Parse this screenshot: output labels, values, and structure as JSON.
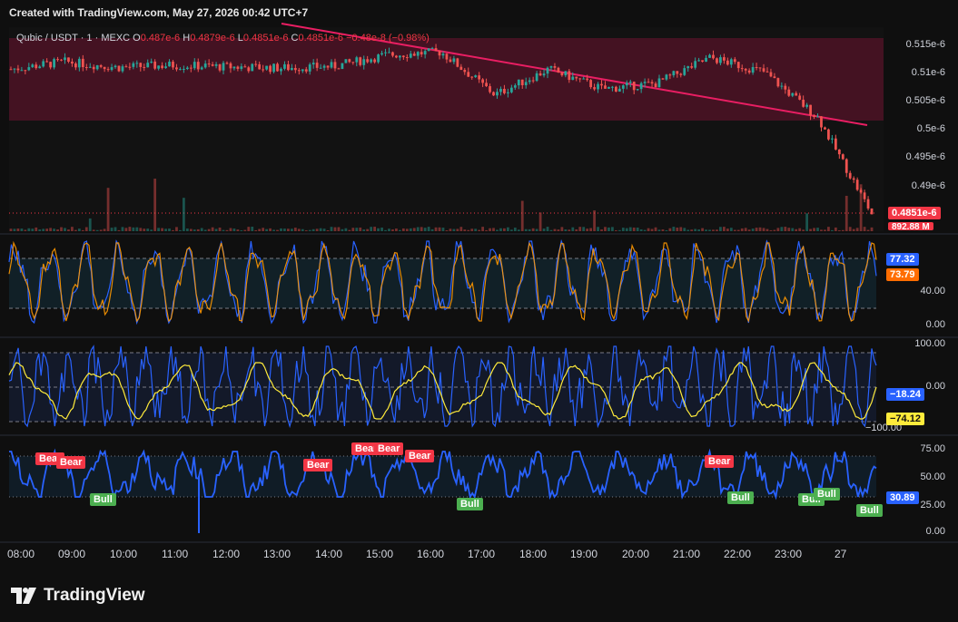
{
  "header": {
    "created_text": "Created with TradingView.com, May 27, 2026 00:42 UTC+7"
  },
  "legend": {
    "symbol": "Qubic / USDT · 1 · MEXC",
    "open_label": "O",
    "open": "0.487e-6",
    "high_label": "H",
    "high": "0.4879e-6",
    "low_label": "L",
    "low": "0.4851e-6",
    "close_label": "C",
    "close": "0.4851e-6",
    "change": "−0.48e-8 (−0.98%)"
  },
  "price_axis": [
    "0.515e-6",
    "0.51e-6",
    "0.505e-6",
    "0.5e-6",
    "0.495e-6",
    "0.49e-6"
  ],
  "current_price": {
    "label": "0.4851e-6",
    "color": "#f23645"
  },
  "volume_label": "892.88 M",
  "osc1": {
    "axis": [
      "40.00",
      "0.00"
    ],
    "value_a": "77.32",
    "value_b": "73.79"
  },
  "osc2": {
    "axis": [
      "100.00",
      "0.00",
      "−100.00"
    ],
    "value_a": "−18.24",
    "value_b": "−74.12"
  },
  "osc3": {
    "axis": [
      "75.00",
      "50.00",
      "25.00",
      "0.00"
    ],
    "value": "30.89",
    "signals": [
      "Bear",
      "Bear",
      "Bear",
      "Bear",
      "Bear",
      "Bear",
      "Bear",
      "Bull",
      "Bull",
      "Bull",
      "Bull",
      "Bull",
      "Bull"
    ]
  },
  "time_axis": [
    "08:00",
    "09:00",
    "10:00",
    "11:00",
    "12:00",
    "13:00",
    "14:00",
    "15:00",
    "16:00",
    "17:00",
    "18:00",
    "19:00",
    "20:00",
    "21:00",
    "22:00",
    "23:00",
    "27"
  ],
  "branding": {
    "logo_text": "TradingView"
  },
  "colors": {
    "bg": "#0f0f0f",
    "up": "#26a69a",
    "down": "#ef5350",
    "trendline": "#e91e63",
    "zone": "#6e1230",
    "osc_blue": "#2962ff",
    "osc_orange": "#ff9800",
    "osc_yellow": "#ffeb3b",
    "bull": "#4caf50",
    "bear": "#f23645"
  },
  "chart_data": {
    "type": "line",
    "title": "Qubic / USDT · 1 · MEXC",
    "x": [
      "08:00",
      "09:00",
      "10:00",
      "11:00",
      "12:00",
      "13:00",
      "14:00",
      "15:00",
      "16:00",
      "17:00",
      "18:00",
      "19:00",
      "20:00",
      "21:00",
      "22:00",
      "23:00",
      "27"
    ],
    "series": [
      {
        "name": "Close",
        "values": [
          0.5105,
          0.5118,
          0.5108,
          0.5112,
          0.5109,
          0.5107,
          0.511,
          0.513,
          0.5135,
          0.506,
          0.5105,
          0.507,
          0.508,
          0.5125,
          0.51,
          0.502,
          0.4851
        ]
      }
    ],
    "ylim": [
      0.4851,
      0.5165
    ],
    "ytick_unit": "e-6",
    "grid": true,
    "legend": "top-left"
  }
}
